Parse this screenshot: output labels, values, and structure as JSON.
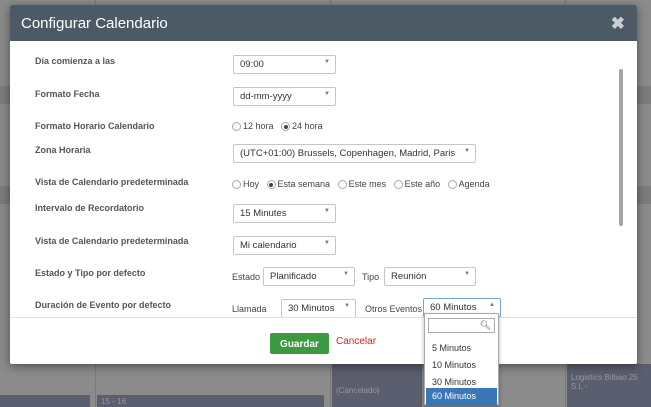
{
  "modal": {
    "title": "Configurar Calendario",
    "close": "✖"
  },
  "fields": {
    "day_start": {
      "label": "Día comienza a las",
      "value": "09:00"
    },
    "date_format": {
      "label": "Formato Fecha",
      "value": "dd-mm-yyyy"
    },
    "time_format": {
      "label": "Formato Horario Calendario",
      "options": [
        "12 hora",
        "24 hora"
      ],
      "selected": "24 hora"
    },
    "timezone": {
      "label": "Zona Horaria",
      "value": "(UTC+01:00) Brussels, Copenhagen, Madrid, Paris"
    },
    "default_view": {
      "label": "Vista de Calendario predeterminada",
      "options": [
        "Hoy",
        "Esta semana",
        "Este mes",
        "Este año",
        "Agenda"
      ],
      "selected": "Esta semana"
    },
    "reminder_interval": {
      "label": "Intervalo de Recordatorio",
      "value": "15 Minutes"
    },
    "default_calendar_view": {
      "label": "Vista de Calendario predeterminada",
      "value": "Mi calendario"
    },
    "status_type": {
      "label": "Estado y Tipo por defecto",
      "estado_label": "Estado",
      "estado_value": "Planificado",
      "tipo_label": "Tipo",
      "tipo_value": "Reunión"
    },
    "event_duration": {
      "label": "Duración de Evento por defecto",
      "llamada_label": "Llamada",
      "llamada_value": "30 Minutos",
      "otros_label": "Otros Eventos",
      "otros_value": "60 Minutos"
    }
  },
  "dropdown": {
    "options": [
      "5 Minutos",
      "10 Minutos",
      "30 Minutos",
      "60 Minutos"
    ],
    "selected": "60 Minutos",
    "search_icon": "search-icon"
  },
  "footer": {
    "save": "Guardar",
    "cancel": "Cancelar"
  },
  "background": {
    "cell1": "15 - 16",
    "cell2": "(Cancelado)",
    "cell3": "Logistics Bilbao 25 S.L -"
  },
  "colors": {
    "header": "#4c5a65",
    "save": "#3b9a3f",
    "cancel": "#dd2222",
    "selected_option": "#3a76b8"
  }
}
